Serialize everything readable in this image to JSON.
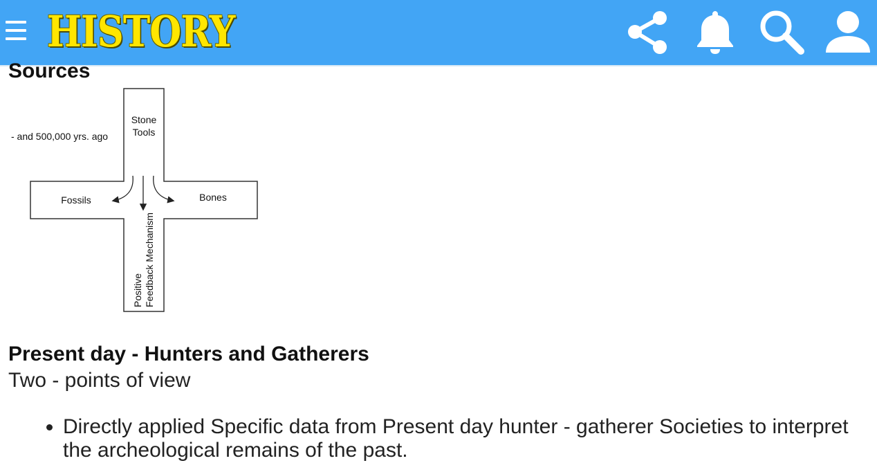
{
  "header": {
    "logo_text": "HISTORY",
    "icons": [
      "menu-icon",
      "share-icon",
      "bell-icon",
      "search-icon",
      "user-icon"
    ],
    "colors": {
      "bar": "#42a5f5",
      "logo": "#ffe600"
    }
  },
  "content": {
    "sources_title": "Sources",
    "diagram": {
      "left_note": "- and 500,000 yrs. ago",
      "top": [
        "Stone",
        "Tools"
      ],
      "left": "Fossils",
      "right": "Bones",
      "bottom": [
        "Positive",
        "Feedback Mechanism"
      ]
    },
    "heading": "Present day - Hunters and Gatherers",
    "subheading": "Two - points of view",
    "bullets": [
      "Directly applied Specific data from Present day hunter - gatherer Societies to interpret the archeological remains of the past."
    ]
  }
}
